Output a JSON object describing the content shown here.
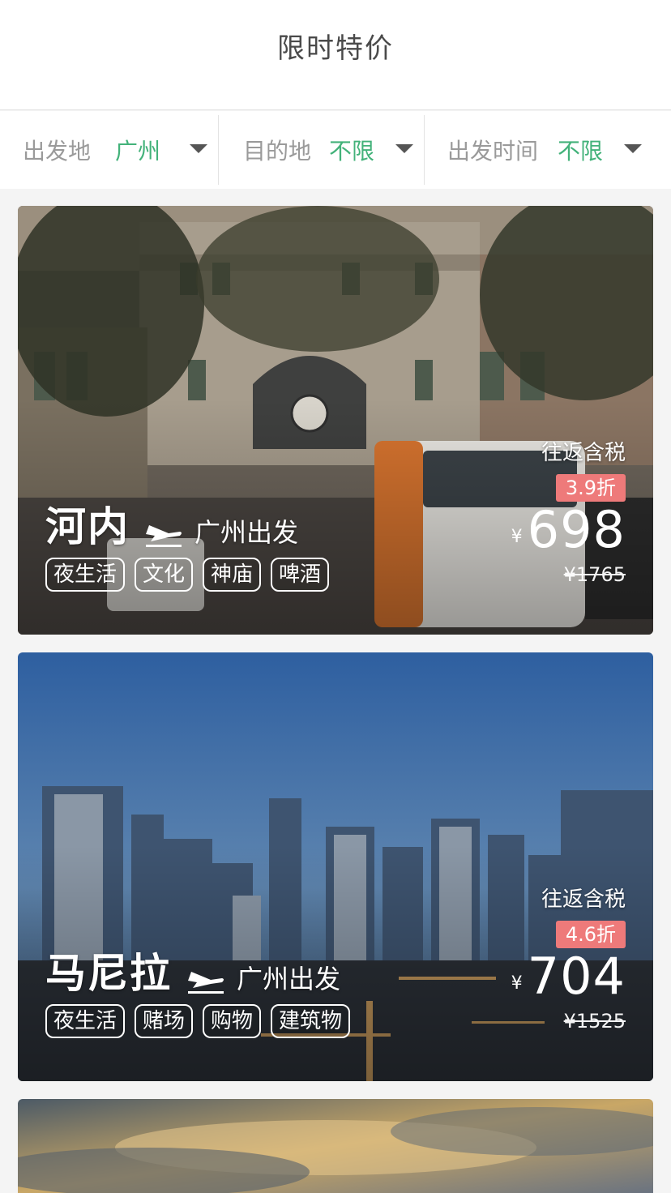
{
  "header": {
    "title": "限时特价"
  },
  "filters": [
    {
      "label": "出发地",
      "value": "广州"
    },
    {
      "label": "目的地",
      "value": "不限"
    },
    {
      "label": "出发时间",
      "value": "不限"
    }
  ],
  "deals": [
    {
      "destination": "河内",
      "departure": "广州出发",
      "tags": [
        "夜生活",
        "文化",
        "神庙",
        "啤酒"
      ],
      "roundtrip": "往返含税",
      "discount": "3.9折",
      "currency": "¥",
      "price": "698",
      "original_price": "¥1765"
    },
    {
      "destination": "马尼拉",
      "departure": "广州出发",
      "tags": [
        "夜生活",
        "赌场",
        "购物",
        "建筑物"
      ],
      "roundtrip": "往返含税",
      "discount": "4.6折",
      "currency": "¥",
      "price": "704",
      "original_price": "¥1525"
    }
  ],
  "colors": {
    "accent_green": "#43b27a",
    "discount_badge": "#ee7a7a",
    "title_gray": "#4a4a4a",
    "label_gray": "#9a9a9a"
  },
  "icons": {
    "plane": "plane-icon",
    "caret": "caret-down-icon"
  }
}
